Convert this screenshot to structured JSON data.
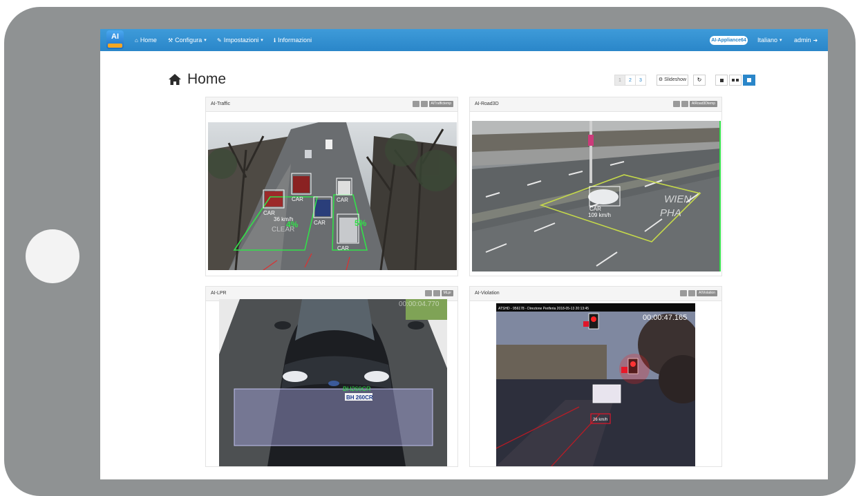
{
  "navbar": {
    "logo_text": "AI",
    "items": [
      {
        "label": "Home",
        "icon": "home-icon"
      },
      {
        "label": "Configura",
        "icon": "wrench-icon",
        "dropdown": true
      },
      {
        "label": "Impostazioni",
        "icon": "settings-icon",
        "dropdown": true
      },
      {
        "label": "Informazioni",
        "icon": "info-icon"
      }
    ],
    "badge": "AI-Appliance64",
    "language": "Italiano",
    "user": "admin"
  },
  "page": {
    "title": "Home",
    "pages": [
      "1",
      "2",
      "3"
    ],
    "active_page": "1",
    "slideshow_label": "Slideshow"
  },
  "panels": [
    {
      "title": "AI-Traffic",
      "tag": "AITraffictemp",
      "overlay": {
        "labels": [
          "CAR",
          "CAR",
          "CAR",
          "CAR",
          "CAR"
        ],
        "speed": "36 km/h",
        "pct1": "4%",
        "pct2": "5%",
        "word": "CLEAR"
      }
    },
    {
      "title": "AI-Road3D",
      "tag": "AIRoad3Dtemp",
      "overlay": {
        "label": "CAR",
        "speed": "109 km/h",
        "road_text": [
          "WIEN",
          "PHA"
        ]
      }
    },
    {
      "title": "AI-LPR",
      "tag": "MLpr",
      "overlay": {
        "timer": "00:00:04.770",
        "plate": "BH 260CR",
        "plate_green": "BH260CR"
      }
    },
    {
      "title": "AI-Violation",
      "tag": "AIViolation",
      "overlay": {
        "info": "ATSHD - 956178 - Direzione Periferia   2018-05-13  20:13:45",
        "timer": "00:00:47.165",
        "small": "26 km/h"
      }
    }
  ],
  "colors": {
    "navbar": "#2a86c9",
    "accent": "#2a86c9",
    "detect_green": "#33e04a",
    "detect_white": "#ffffff",
    "violation_red": "#e0162b",
    "tablet_frame": "#8f9293"
  }
}
